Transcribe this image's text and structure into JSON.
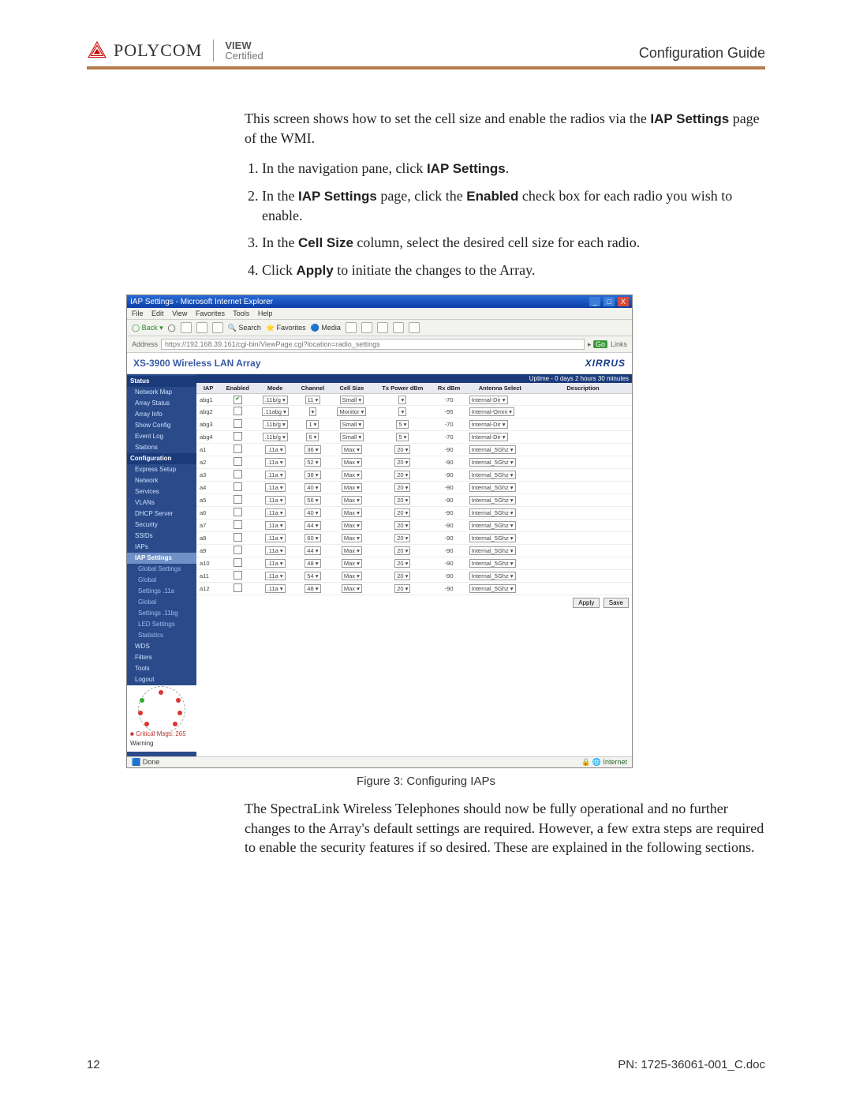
{
  "header": {
    "brand_polycom": "POLYCOM",
    "brand_view": "VIEW",
    "brand_cert": "Certified",
    "title": "Configuration Guide"
  },
  "intro": "This screen shows how to set the cell size and enable the radios via the ",
  "intro_bold": "IAP Settings",
  "intro_tail": " page of the WMI.",
  "steps": {
    "s1a": "In the navigation pane, click ",
    "s1b": "IAP Settings",
    "s1c": ".",
    "s2a": "In the ",
    "s2b": "IAP Settings",
    "s2c": " page, click the ",
    "s2d": "Enabled",
    "s2e": " check box for each radio you wish to enable.",
    "s3a": "In the ",
    "s3b": "Cell Size",
    "s3c": " column, select the desired cell size for each radio.",
    "s4a": "Click ",
    "s4b": "Apply",
    "s4c": " to initiate the changes to the Array."
  },
  "screenshot": {
    "title": "IAP Settings - Microsoft Internet Explorer",
    "win_min": "_",
    "win_max": "□",
    "win_close": "X",
    "menu": {
      "file": "File",
      "edit": "Edit",
      "view": "View",
      "fav": "Favorites",
      "tools": "Tools",
      "help": "Help"
    },
    "toolbar": {
      "back": "Back",
      "search": "Search",
      "favorites": "Favorites",
      "media": "Media"
    },
    "address_label": "Address",
    "url": "https://192.168.39.161/cgi-bin/ViewPage.cgi?location=radio_settings",
    "go": "Go",
    "links": "Links",
    "app_title": "XS-3900 Wireless LAN Array",
    "xirrus": "XIRRUS",
    "uptime": "Uptime - 0 days 2 hours 30 minutes",
    "nav": {
      "status": "Status",
      "netmap": "Network Map",
      "arrstatus": "Array Status",
      "arrinfo": "Array Info",
      "showconf": "Show Config",
      "eventlog": "Event Log",
      "stations": "Stations",
      "config": "Configuration",
      "express": "Express Setup",
      "network": "Network",
      "services": "Services",
      "vlans": "VLANs",
      "dhcp": "DHCP Server",
      "security": "Security",
      "ssids": "SSIDs",
      "iaps": "IAPs",
      "iapsettings": "IAP Settings",
      "gsglobal": "Global Settings",
      "global": "Global",
      "set11a": "Settings .11a",
      "global2": "Global",
      "set11bg": "Settings .11bg",
      "led": "LED Settings",
      "stats": "Statistics",
      "wds": "WDS",
      "filters": "Filters",
      "tools": "Tools",
      "logout": "Logout"
    },
    "crit": "Critical Msgs: 265",
    "warn": "Warning",
    "headers": {
      "iap": "IAP",
      "enabled": "Enabled",
      "mode": "Mode",
      "channel": "Channel",
      "cellsize": "Cell Size",
      "txpower": "Tx Power dBm",
      "rxdbm": "Rx dBm",
      "antenna": "Antenna Select",
      "desc": "Description"
    },
    "rows": [
      {
        "iap": "abg1",
        "en": true,
        "mode": ".11b/g",
        "ch": "11",
        "cell": "Small",
        "tx": "",
        "rx": "-70",
        "ant": "Internal-Dir"
      },
      {
        "iap": "abg2",
        "en": false,
        "mode": ".11abg",
        "ch": "",
        "cell": "Monitor",
        "tx": "",
        "rx": "-95",
        "ant": "Internal-Omni"
      },
      {
        "iap": "abg3",
        "en": false,
        "mode": ".11b/g",
        "ch": "1",
        "cell": "Small",
        "tx": "5",
        "rx": "-70",
        "ant": "Internal-Dir"
      },
      {
        "iap": "abg4",
        "en": false,
        "mode": ".11b/g",
        "ch": "6",
        "cell": "Small",
        "tx": "5",
        "rx": "-70",
        "ant": "Internal-Dir"
      },
      {
        "iap": "a1",
        "en": false,
        "mode": ".11a",
        "ch": "36",
        "cell": "Max",
        "tx": "20",
        "rx": "-90",
        "ant": "Internal_5Ghz"
      },
      {
        "iap": "a2",
        "en": false,
        "mode": ".11a",
        "ch": "52",
        "cell": "Max",
        "tx": "20",
        "rx": "-90",
        "ant": "Internal_5Ghz"
      },
      {
        "iap": "a3",
        "en": false,
        "mode": ".11a",
        "ch": "38",
        "cell": "Max",
        "tx": "20",
        "rx": "-90",
        "ant": "Internal_5Ghz"
      },
      {
        "iap": "a4",
        "en": false,
        "mode": ".11a",
        "ch": "40",
        "cell": "Max",
        "tx": "20",
        "rx": "-90",
        "ant": "Internal_5Ghz"
      },
      {
        "iap": "a5",
        "en": false,
        "mode": ".11a",
        "ch": "56",
        "cell": "Max",
        "tx": "20",
        "rx": "-90",
        "ant": "Internal_5Ghz"
      },
      {
        "iap": "a6",
        "en": false,
        "mode": ".11a",
        "ch": "40",
        "cell": "Max",
        "tx": "20",
        "rx": "-90",
        "ant": "Internal_5Ghz"
      },
      {
        "iap": "a7",
        "en": false,
        "mode": ".11a",
        "ch": "44",
        "cell": "Max",
        "tx": "20",
        "rx": "-90",
        "ant": "Internal_5Ghz"
      },
      {
        "iap": "a8",
        "en": false,
        "mode": ".11a",
        "ch": "60",
        "cell": "Max",
        "tx": "20",
        "rx": "-90",
        "ant": "Internal_5Ghz"
      },
      {
        "iap": "a9",
        "en": false,
        "mode": ".11a",
        "ch": "44",
        "cell": "Max",
        "tx": "20",
        "rx": "-90",
        "ant": "Internal_5Ghz"
      },
      {
        "iap": "a10",
        "en": false,
        "mode": ".11a",
        "ch": "48",
        "cell": "Max",
        "tx": "20",
        "rx": "-90",
        "ant": "Internal_5Ghz"
      },
      {
        "iap": "a11",
        "en": false,
        "mode": ".11a",
        "ch": "54",
        "cell": "Max",
        "tx": "20",
        "rx": "-90",
        "ant": "Internal_5Ghz"
      },
      {
        "iap": "a12",
        "en": false,
        "mode": ".11a",
        "ch": "48",
        "cell": "Max",
        "tx": "20",
        "rx": "-90",
        "ant": "Internal_5Ghz"
      }
    ],
    "apply": "Apply",
    "save": "Save",
    "done": "Done",
    "internet": "Internet"
  },
  "caption": "Figure 3: Configuring IAPs",
  "after": "The SpectraLink Wireless Telephones should now be fully operational and no further changes to the Array's default settings are required. However, a few extra steps are required to enable the security features if so desired. These are explained in the following sections.",
  "footer": {
    "page": "12",
    "pn": "PN: 1725-36061-001_C.doc"
  }
}
